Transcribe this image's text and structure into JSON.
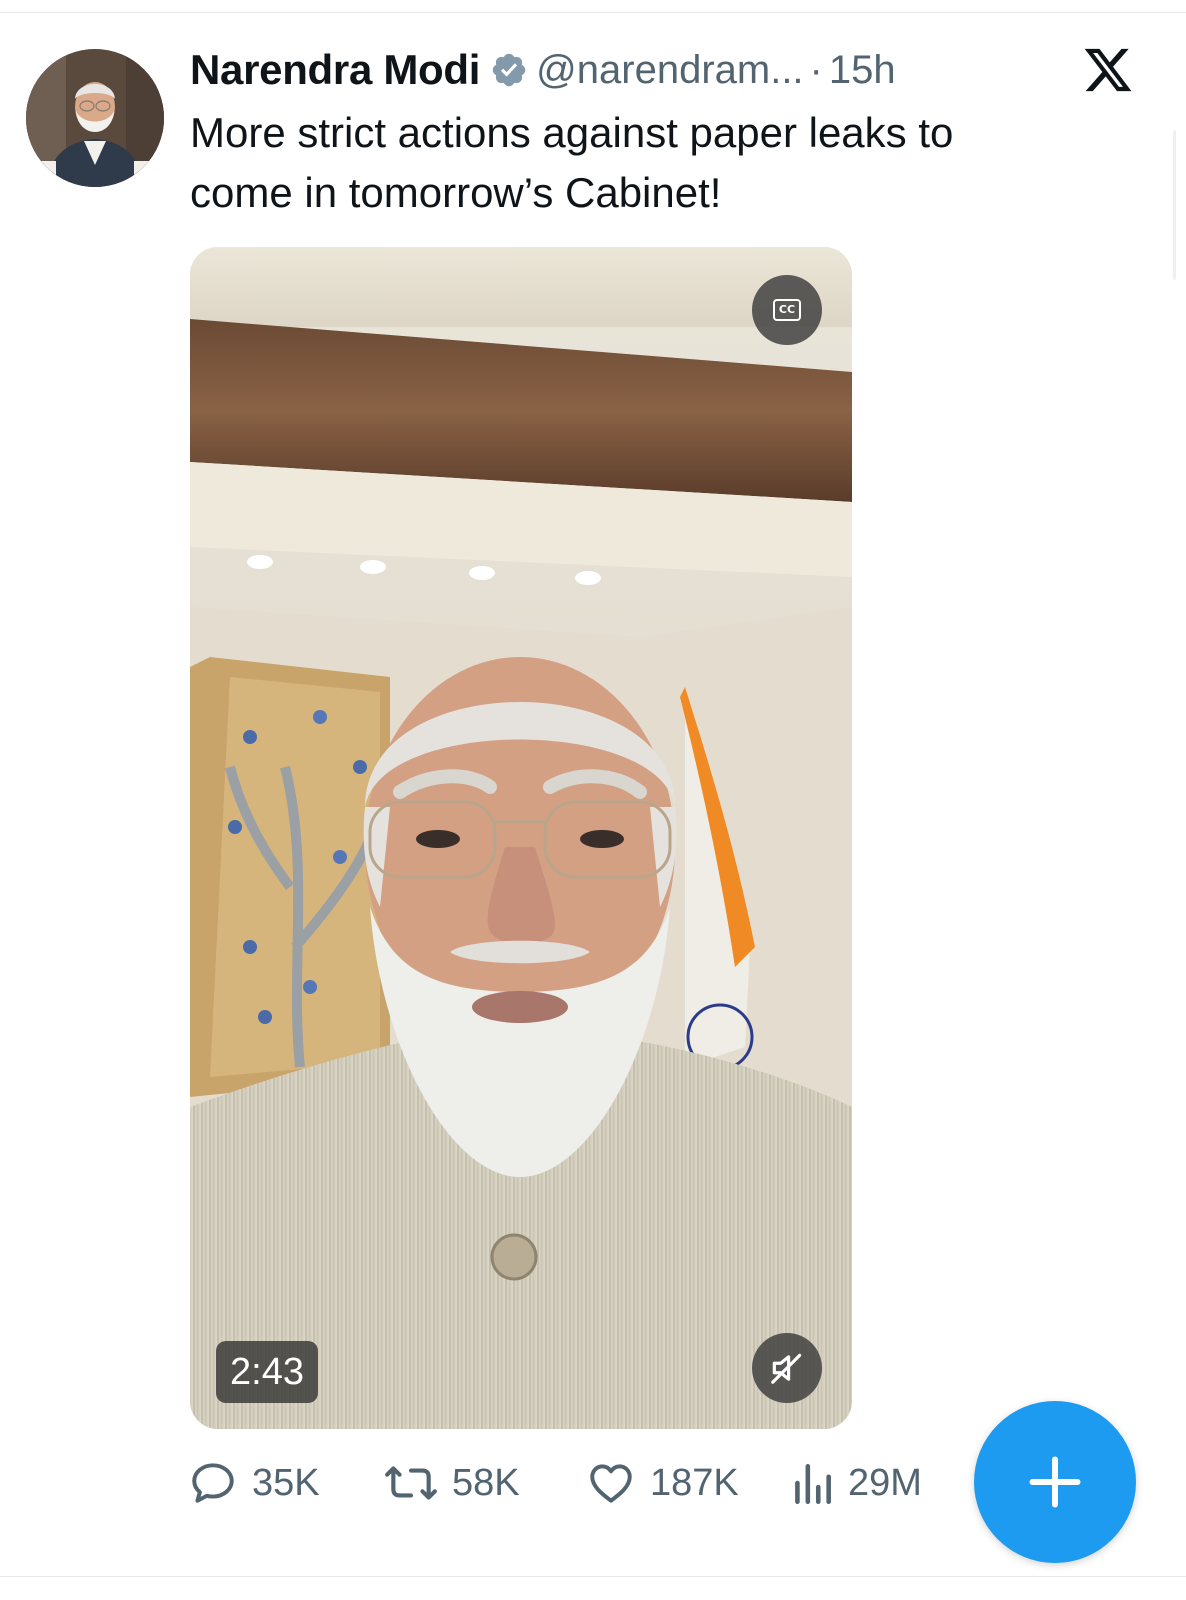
{
  "tweet": {
    "author": {
      "display_name": "Narendra Modi",
      "handle": "@narendram...",
      "verified": true
    },
    "separator": "·",
    "timestamp": "15h",
    "text_line1": "More strict actions against paper leaks to",
    "text_line2": "come in tomorrow’s Cabinet!",
    "media": {
      "type": "video",
      "duration": "2:43",
      "captions_button": "CC",
      "muted": true
    },
    "stats": {
      "replies": "35K",
      "reposts": "58K",
      "likes": "187K",
      "views": "29M"
    }
  },
  "colors": {
    "accent": "#1d9bf0",
    "verified_badge": "#829aab",
    "text_primary": "#0f1419",
    "text_secondary": "#536471"
  },
  "icons": {
    "brand": "x-logo-icon",
    "verified": "verified-badge-icon",
    "reply": "speech-bubble-icon",
    "repost": "repost-arrows-icon",
    "like": "heart-icon",
    "views": "bar-chart-icon",
    "mute": "speaker-muted-icon",
    "compose": "plus-icon"
  }
}
